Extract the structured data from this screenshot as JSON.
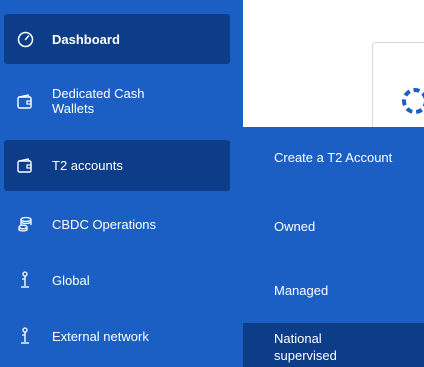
{
  "sidebar": {
    "items": [
      {
        "label": "Dashboard",
        "icon": "speedometer-icon"
      },
      {
        "label": "Dedicated Cash Wallets",
        "icon": "wallet-icon"
      },
      {
        "label": "T2 accounts",
        "icon": "wallet-icon"
      },
      {
        "label": "CBDC Operations",
        "icon": "database-icon"
      },
      {
        "label": "Global",
        "icon": "bank-icon"
      },
      {
        "label": "External network",
        "icon": "bank-icon"
      }
    ]
  },
  "submenu": {
    "items": [
      {
        "label": "Create a T2 Account"
      },
      {
        "label": "Owned"
      },
      {
        "label": "Managed"
      },
      {
        "label": "National supervised"
      }
    ]
  },
  "colors": {
    "sidebar_bg": "#1b5fc4",
    "active_bg": "#0d3d88",
    "text": "#ffffff",
    "spinner": "#1b5fc4"
  }
}
